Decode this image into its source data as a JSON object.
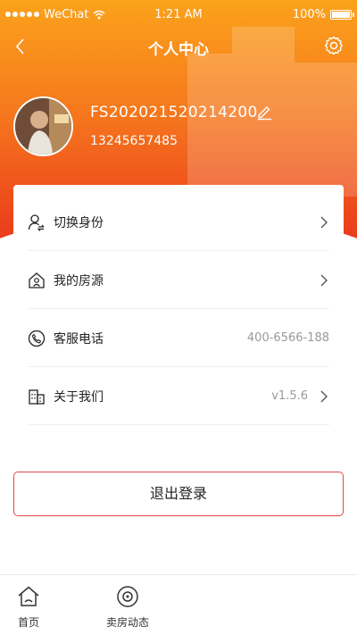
{
  "status_bar": {
    "carrier": "WeChat",
    "time": "1:21 AM",
    "battery": "100%"
  },
  "nav": {
    "title": "个人中心"
  },
  "profile": {
    "user_id": "FS20202152021420​0",
    "phone": "13245657485"
  },
  "menu": {
    "items": [
      {
        "label": "切换身份",
        "value": "",
        "icon": "switch-user-icon"
      },
      {
        "label": "我的房源",
        "value": "",
        "icon": "house-icon"
      },
      {
        "label": "客服电话",
        "value": "400-6566-188",
        "icon": "phone-icon"
      },
      {
        "label": "关于我们",
        "value": "v1.5.6",
        "icon": "building-icon"
      }
    ]
  },
  "logout_label": "退出登录",
  "tabbar": {
    "items": [
      {
        "label": "首页",
        "icon": "home-icon"
      },
      {
        "label": "卖房动态",
        "icon": "sell-activity-icon"
      }
    ]
  },
  "colors": {
    "header_top": "#fba21b",
    "header_bottom": "#ea3b1c",
    "logout_border": "#e24a4a"
  }
}
